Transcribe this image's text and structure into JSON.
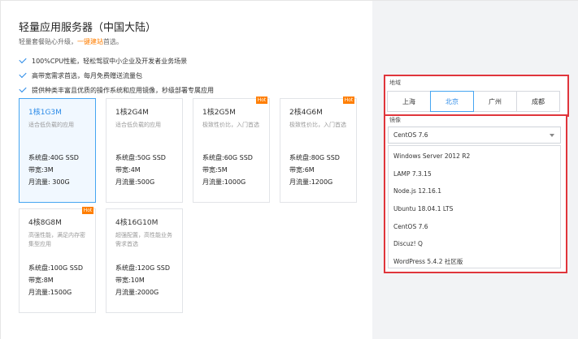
{
  "header": {
    "title": "轻量应用服务器（中国大陆）",
    "subtitle_prefix": "轻量套餐贴心升级，",
    "subtitle_highlight": "一键建站",
    "subtitle_suffix": "首选。"
  },
  "features": [
    "100%CPU性能，轻松驾驭中小企业及开发者业务场景",
    "高带宽需求首选，每月免费赠送流量包",
    "提供种类丰富且优质的操作系统和应用镜像，秒级部署专属应用"
  ],
  "plans": [
    {
      "name": "1核1G3M",
      "desc": "适合低负载的应用",
      "disk": "系统盘:40G SSD",
      "bandwidth": "带宽:3M",
      "traffic": "月流量: 300G"
    },
    {
      "name": "1核2G4M",
      "desc": "适合低负载的应用",
      "disk": "系统盘:50G SSD",
      "bandwidth": "带宽:4M",
      "traffic": "月流量:500G"
    },
    {
      "name": "1核2G5M",
      "desc": "极致性价比，入门首选",
      "disk": "系统盘:60G SSD",
      "bandwidth": "带宽:5M",
      "traffic": "月流量:1000G",
      "badge": "Hot"
    },
    {
      "name": "2核4G6M",
      "desc": "极致性价比，入门首选",
      "disk": "系统盘:80G SSD",
      "bandwidth": "带宽:6M",
      "traffic": "月流量:1200G",
      "badge": "Hot"
    },
    {
      "name": "4核8G8M",
      "desc": "高强性能，满足内存密集型应用",
      "disk": "系统盘:100G SSD",
      "bandwidth": "带宽:8M",
      "traffic": "月流量:1500G",
      "badge": "Hot"
    },
    {
      "name": "4核16G10M",
      "desc": "超强配置，高性能业务需求首选",
      "disk": "系统盘:120G SSD",
      "bandwidth": "带宽:10M",
      "traffic": "月流量:2000G"
    }
  ],
  "region": {
    "label": "地域",
    "options": [
      "上海",
      "北京",
      "广州",
      "成都"
    ],
    "selected": "北京"
  },
  "image": {
    "label": "镜像",
    "selected": "CentOS 7.6",
    "options": [
      "Windows Server 2012 R2",
      "LAMP 7.3.15",
      "Node.js 12.16.1",
      "Ubuntu 18.04.1 LTS",
      "CentOS 7.6",
      "Discuz! Q",
      "WordPress 5.4.2 社区版"
    ]
  },
  "colors": {
    "accent": "#2a8ae8",
    "highlight": "#ff7e00",
    "annotation_box": "#e0353b",
    "panel_bg": "#f2f3f5"
  }
}
